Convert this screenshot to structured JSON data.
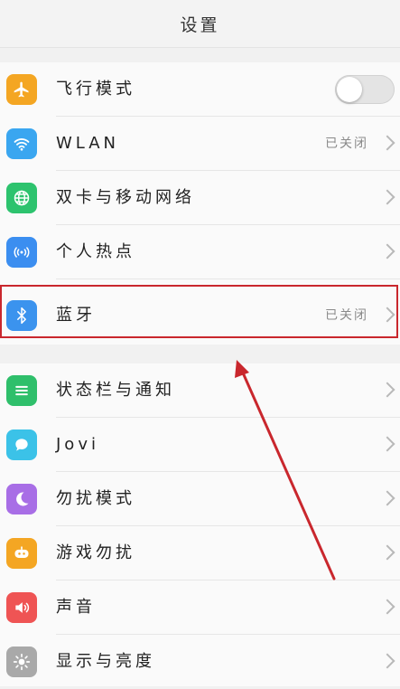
{
  "header": {
    "title": "设置"
  },
  "group1": [
    {
      "label": "飞行模式",
      "status": "",
      "control": "toggle",
      "toggle_on": false,
      "icon": "airplane-icon",
      "color": "#f4a623"
    },
    {
      "label": "WLAN",
      "status": "已关闭",
      "control": "chevron",
      "icon": "wifi-icon",
      "color": "#3aa6f0"
    },
    {
      "label": "双卡与移动网络",
      "status": "",
      "control": "chevron",
      "icon": "globe-icon",
      "color": "#2dc36e"
    },
    {
      "label": "个人热点",
      "status": "",
      "control": "chevron",
      "icon": "hotspot-icon",
      "color": "#3b8ef0"
    },
    {
      "label": "蓝牙",
      "status": "已关闭",
      "control": "chevron",
      "icon": "bluetooth-icon",
      "color": "#3b93ee"
    }
  ],
  "group2": [
    {
      "label": "状态栏与通知",
      "status": "",
      "control": "chevron",
      "icon": "notification-list-icon",
      "color": "#2fbf6b"
    },
    {
      "label": "Jovi",
      "status": "",
      "control": "chevron",
      "icon": "jovi-icon",
      "color": "#3bc2e8"
    },
    {
      "label": "勿扰模式",
      "status": "",
      "control": "chevron",
      "icon": "moon-icon",
      "color": "#a86ee6"
    },
    {
      "label": "游戏勿扰",
      "status": "",
      "control": "chevron",
      "icon": "gamepad-icon",
      "color": "#f4a623"
    },
    {
      "label": "声音",
      "status": "",
      "control": "chevron",
      "icon": "speaker-icon",
      "color": "#ef5454"
    },
    {
      "label": "显示与亮度",
      "status": "",
      "control": "chevron",
      "icon": "brightness-icon",
      "color": "#a9a9a9"
    }
  ],
  "annotation": {
    "highlight_color": "#c9272d",
    "highlighted_item": "蓝牙"
  }
}
